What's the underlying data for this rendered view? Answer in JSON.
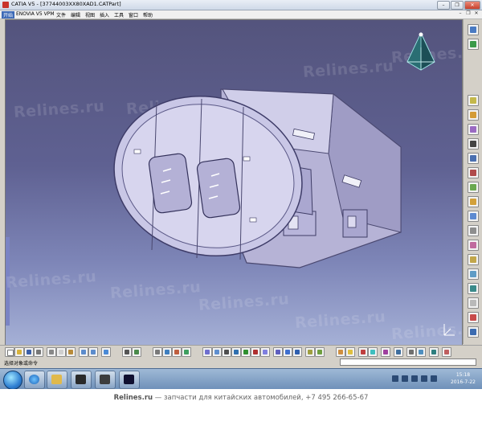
{
  "window": {
    "title": "CATIA V5 - [37744003XX80XAD1.CATPart]",
    "minimize": "–",
    "restore": "❐",
    "close": "✕"
  },
  "menubar": {
    "items": [
      "开始",
      "ENOVIA V5 VPM",
      "文件",
      "编辑",
      "视图",
      "插入",
      "工具",
      "窗口",
      "帮助"
    ],
    "doc_controls": [
      "–",
      "❐",
      "✕"
    ]
  },
  "viewport": {
    "watermark": "Relines.ru",
    "background_top": "#54547d",
    "background_bottom": "#a5b0d6",
    "part_color": "#c6c4e4"
  },
  "statusbar": {
    "prompt": "选择对象或命令",
    "command_value": ""
  },
  "taskbar": {
    "time": "15:18",
    "date": "2016-7-22"
  },
  "footer": {
    "site": "Relines.ru",
    "tagline": "— запчасти для китайских автомобилей, +7 495 266-65-67"
  },
  "colors": {
    "accent_blue": "#3d6ab7",
    "close_red": "#c7402c"
  }
}
